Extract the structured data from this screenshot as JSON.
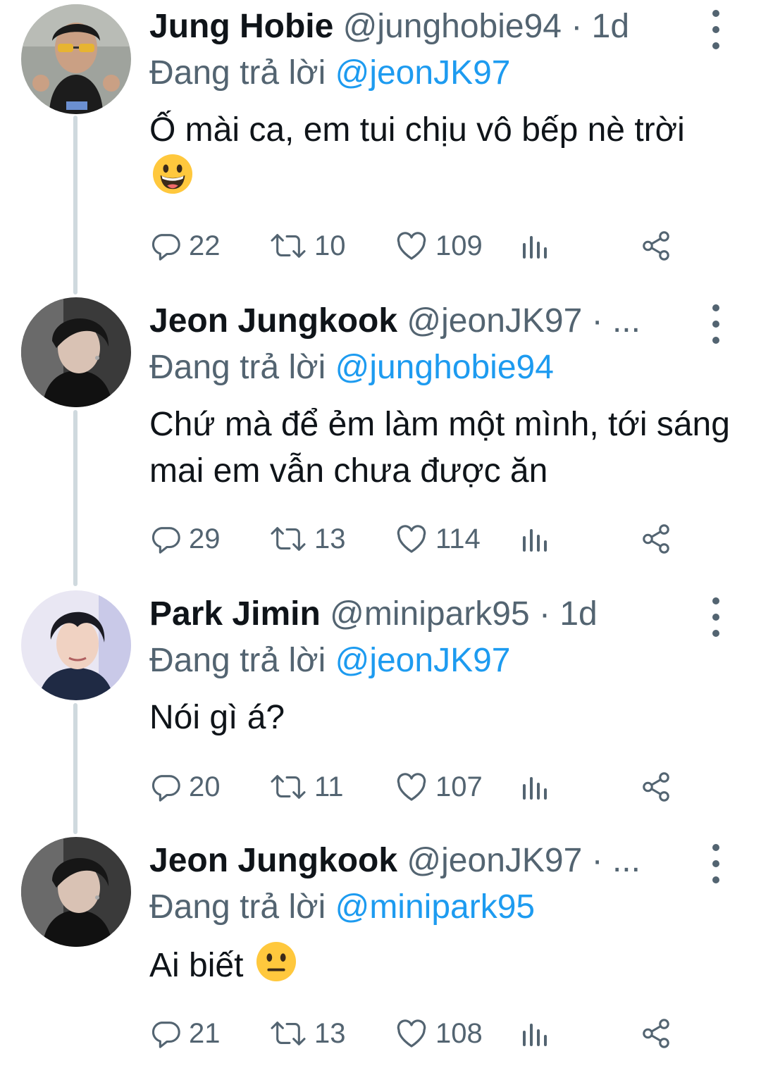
{
  "tweets": [
    {
      "name": "Jung Hobie",
      "handle": "@junghobie94",
      "dot": "·",
      "time": "1d",
      "reply_prefix": "Đang trả lời",
      "reply_to": "@jeonJK97",
      "text": "Ố mài ca, em tui chịu vô bếp nè trời",
      "emoji": "grinning-face",
      "replies": "22",
      "retweets": "10",
      "likes": "109"
    },
    {
      "name": "Jeon Jungkook",
      "handle": "@jeonJK97",
      "dot": "·",
      "time": "...",
      "reply_prefix": "Đang trả lời",
      "reply_to": "@junghobie94",
      "text": "Chứ mà để ẻm làm một mình, tới sáng mai em vẫn chưa được ăn",
      "replies": "29",
      "retweets": "13",
      "likes": "114"
    },
    {
      "name": "Park Jimin",
      "handle": "@minipark95",
      "dot": "·",
      "time": "1d",
      "reply_prefix": "Đang trả lời",
      "reply_to": "@jeonJK97",
      "text": "Nói gì á?",
      "replies": "20",
      "retweets": "11",
      "likes": "107"
    },
    {
      "name": "Jeon Jungkook",
      "handle": "@jeonJK97",
      "dot": "·",
      "time": "...",
      "reply_prefix": "Đang trả lời",
      "reply_to": "@minipark95",
      "text": "Ai biết",
      "emoji": "neutral-face",
      "replies": "21",
      "retweets": "13",
      "likes": "108"
    }
  ],
  "colors": {
    "link": "#1d9bf0",
    "secondary": "#536471",
    "thread_line": "#cfd9de",
    "emoji": "#ffc83d"
  },
  "icons": [
    "reply-icon",
    "retweet-icon",
    "like-icon",
    "views-icon",
    "share-icon",
    "more-options-icon"
  ]
}
